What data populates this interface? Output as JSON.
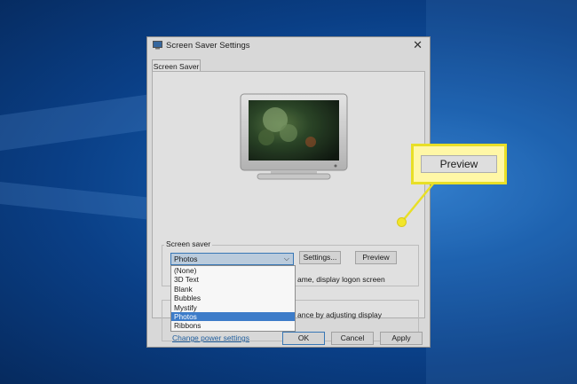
{
  "window": {
    "title": "Screen Saver Settings",
    "close_glyph": "✕"
  },
  "tabs": [
    {
      "label": "Screen Saver"
    }
  ],
  "screen_saver_group": {
    "label": "Screen saver",
    "selected": "Photos",
    "options": [
      "(None)",
      "3D Text",
      "Blank",
      "Bubbles",
      "Mystify",
      "Photos",
      "Ribbons"
    ],
    "settings_label": "Settings...",
    "preview_label": "Preview"
  },
  "obscured_text": {
    "logon": "ame, display logon screen",
    "power": "ance by adjusting display"
  },
  "power_link": "Change power settings",
  "footer": {
    "ok": "OK",
    "cancel": "Cancel",
    "apply": "Apply"
  },
  "callout": {
    "label": "Preview",
    "color": "#e8df27"
  },
  "icons": {
    "dropdown": "chevron-down-icon",
    "window": "monitor-icon"
  }
}
